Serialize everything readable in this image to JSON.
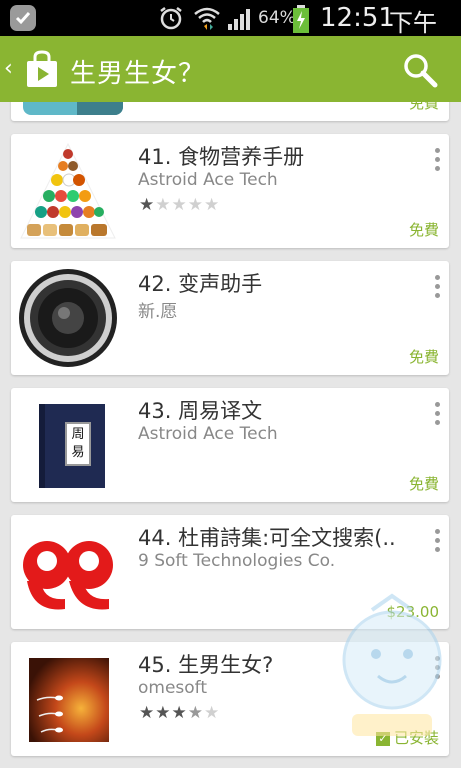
{
  "status_bar": {
    "battery": "64%",
    "time": "12:51",
    "ampm": "下午"
  },
  "action_bar": {
    "title": "生男生女？"
  },
  "partial_card": {
    "price": "免費"
  },
  "apps": [
    {
      "title": "41. 食物营养手册",
      "developer": "Astroid Ace Tech",
      "rating": 1,
      "price": "免費"
    },
    {
      "title": "42. 变声助手",
      "developer": "新.愿",
      "price": "免費"
    },
    {
      "title": "43. 周易译文",
      "developer": "Astroid Ace Tech",
      "price": "免費",
      "book_label": "周易"
    },
    {
      "title": "44. 杜甫詩集:可全文搜索(..",
      "developer": "9 Soft Technologies Co.",
      "price": "$23.00"
    },
    {
      "title": "45. 生男生女?",
      "developer": "omesoft",
      "rating": 3.5,
      "price": "已安裝"
    }
  ],
  "colors": {
    "accent": "#8ab532",
    "statusbar": "#000000",
    "background": "#e6e6e6"
  }
}
